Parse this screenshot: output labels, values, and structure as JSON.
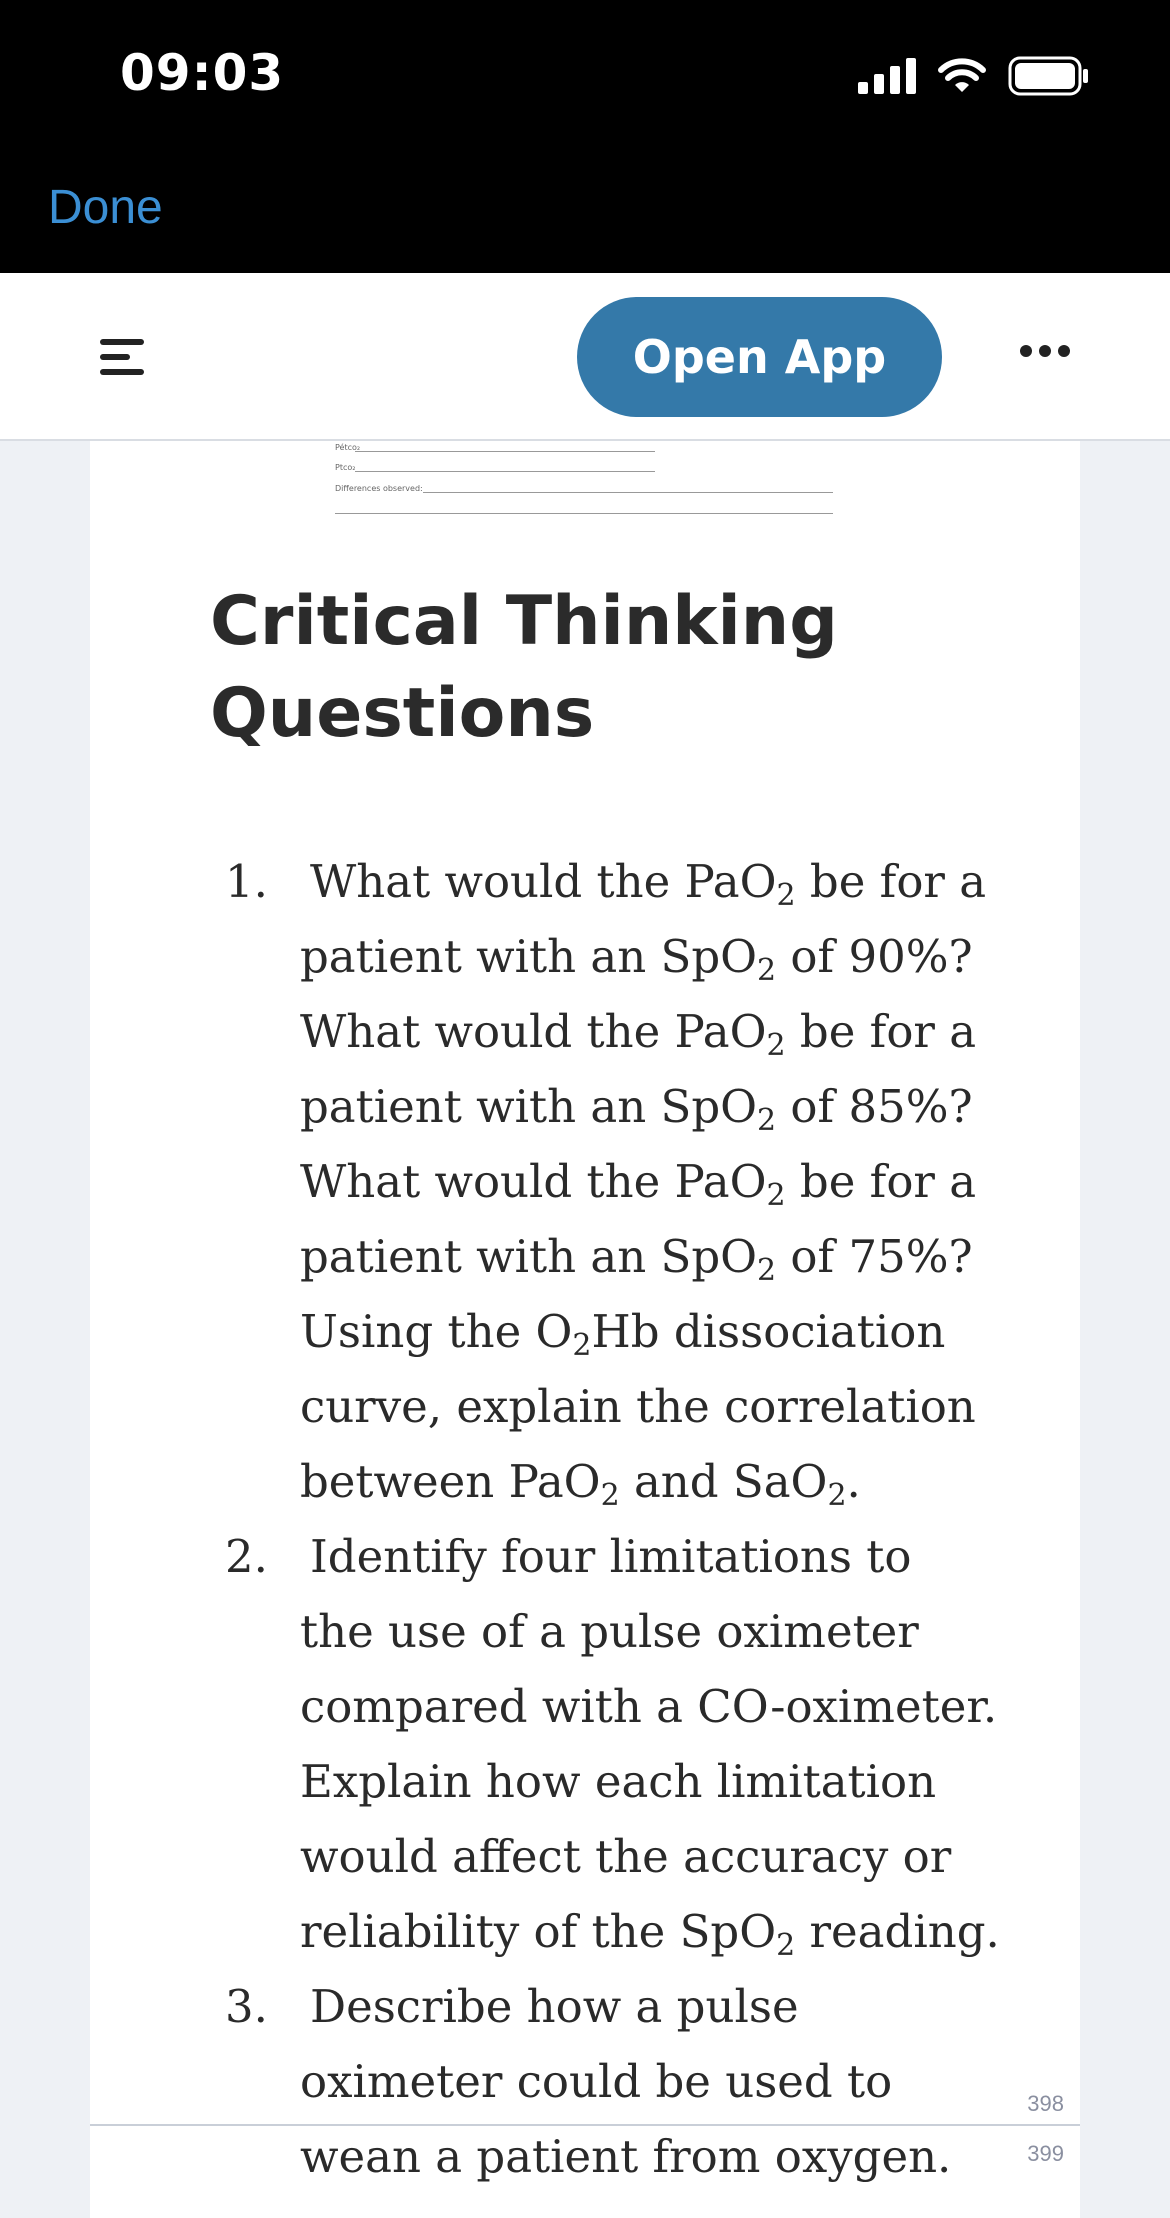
{
  "status_bar": {
    "time": "09:03"
  },
  "nav": {
    "done_label": "Done"
  },
  "toolbar": {
    "open_app_label": "Open App"
  },
  "form_snippet": {
    "row1": "Pétco₂",
    "row2": "Ptco₂",
    "row3": "Differences observed:"
  },
  "heading": {
    "line1": "Critical Thinking",
    "line2": "Questions"
  },
  "questions": {
    "q1": {
      "num": "1.",
      "l1a": "What would the PaO",
      "l1b": " be for a",
      "l2a": "patient with an SpO",
      "l2b": " of 90%?",
      "l3a": "What would the PaO",
      "l3b": " be for a",
      "l4a": "patient with an SpO",
      "l4b": " of 85%?",
      "l5a": "What would the PaO",
      "l5b": " be for a",
      "l6a": "patient with an SpO",
      "l6b": " of 75%?",
      "l7a": "Using the O",
      "l7b": "Hb dissociation",
      "l8": "curve, explain the correlation",
      "l9a": "between PaO",
      "l9b": " and SaO",
      "l9c": "."
    },
    "q2": {
      "num": "2.",
      "l1": "Identify four limitations to",
      "l2": "the use of a pulse oximeter",
      "l3": "compared with a CO-oximeter.",
      "l4": "Explain how each limitation",
      "l5": "would affect the accuracy or",
      "l6a": "reliability of the SpO",
      "l6b": " reading."
    },
    "q3": {
      "num": "3.",
      "l1": "Describe how a pulse",
      "l2": "oximeter could be used to",
      "l3": "wean a patient from oxygen."
    },
    "sub2": "2"
  },
  "page_numbers": {
    "current": "398",
    "next": "399"
  }
}
